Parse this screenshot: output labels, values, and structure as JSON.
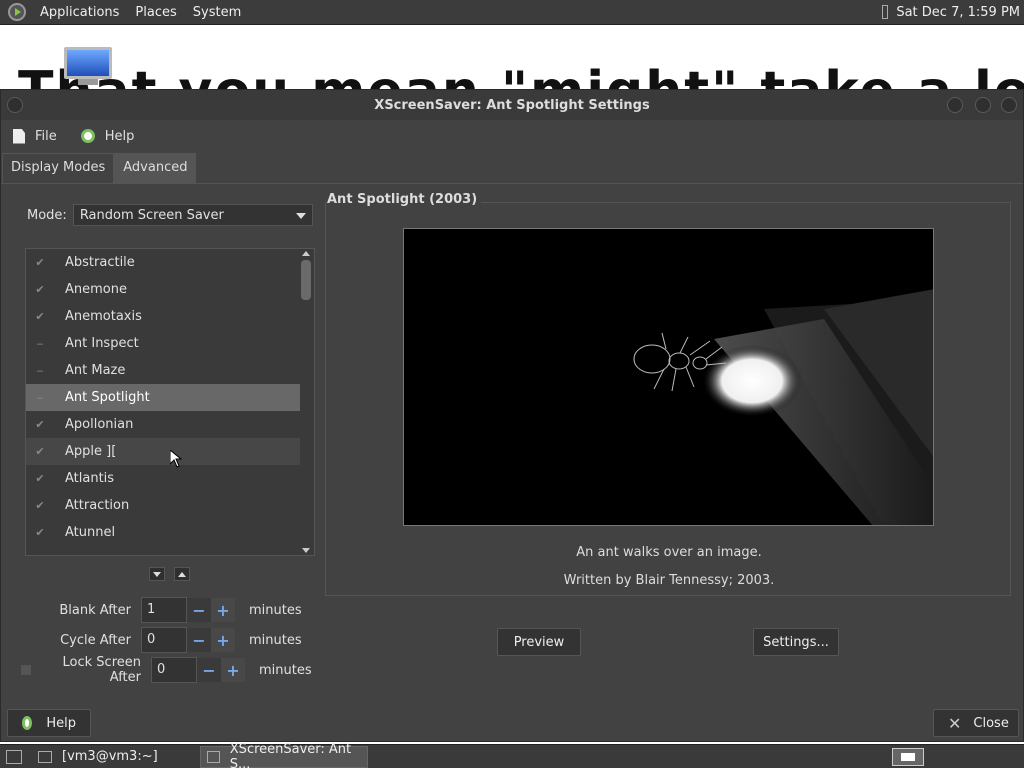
{
  "top_panel": {
    "menus": [
      "Applications",
      "Places",
      "System"
    ],
    "clock": "Sat Dec 7, 1:59 PM"
  },
  "desktop": {
    "background_text": "That you mean \"might\" take a look at me"
  },
  "window": {
    "title": "XScreenSaver: Ant Spotlight Settings",
    "menu": {
      "file": "File",
      "help": "Help"
    },
    "tabs": [
      "Display Modes",
      "Advanced"
    ]
  },
  "mode": {
    "label": "Mode:",
    "value": "Random Screen Saver"
  },
  "savers": [
    {
      "label": "Abstractile",
      "checked": true
    },
    {
      "label": "Anemone",
      "checked": true
    },
    {
      "label": "Anemotaxis",
      "checked": true
    },
    {
      "label": "Ant Inspect",
      "checked": false
    },
    {
      "label": "Ant Maze",
      "checked": false
    },
    {
      "label": "Ant Spotlight",
      "checked": false
    },
    {
      "label": "Apollonian",
      "checked": true
    },
    {
      "label": "Apple ][",
      "checked": true
    },
    {
      "label": "Atlantis",
      "checked": true
    },
    {
      "label": "Attraction",
      "checked": true
    },
    {
      "label": "Atunnel",
      "checked": true
    }
  ],
  "selected_saver": "Ant Spotlight",
  "timing": {
    "blank_after": {
      "label": "Blank After",
      "value": "1",
      "unit": "minutes"
    },
    "cycle_after": {
      "label": "Cycle After",
      "value": "0",
      "unit": "minutes"
    },
    "lock_after": {
      "label": "Lock Screen After",
      "value": "0",
      "unit": "minutes"
    }
  },
  "preview": {
    "title": "Ant Spotlight (2003)",
    "description": "An ant walks over an image.",
    "credit": "Written by Blair Tennessy; 2003.",
    "preview_button": "Preview",
    "settings_button": "Settings..."
  },
  "bottom": {
    "help": "Help",
    "close": "Close"
  },
  "taskbar": {
    "tasks": [
      "[vm3@vm3:~]",
      "XScreenSaver: Ant S..."
    ]
  },
  "colors": {
    "window_bg": "#424242",
    "accent_blue": "#7aa8e6",
    "help_green": "#7fbf5f",
    "selected_row": "#686868"
  }
}
